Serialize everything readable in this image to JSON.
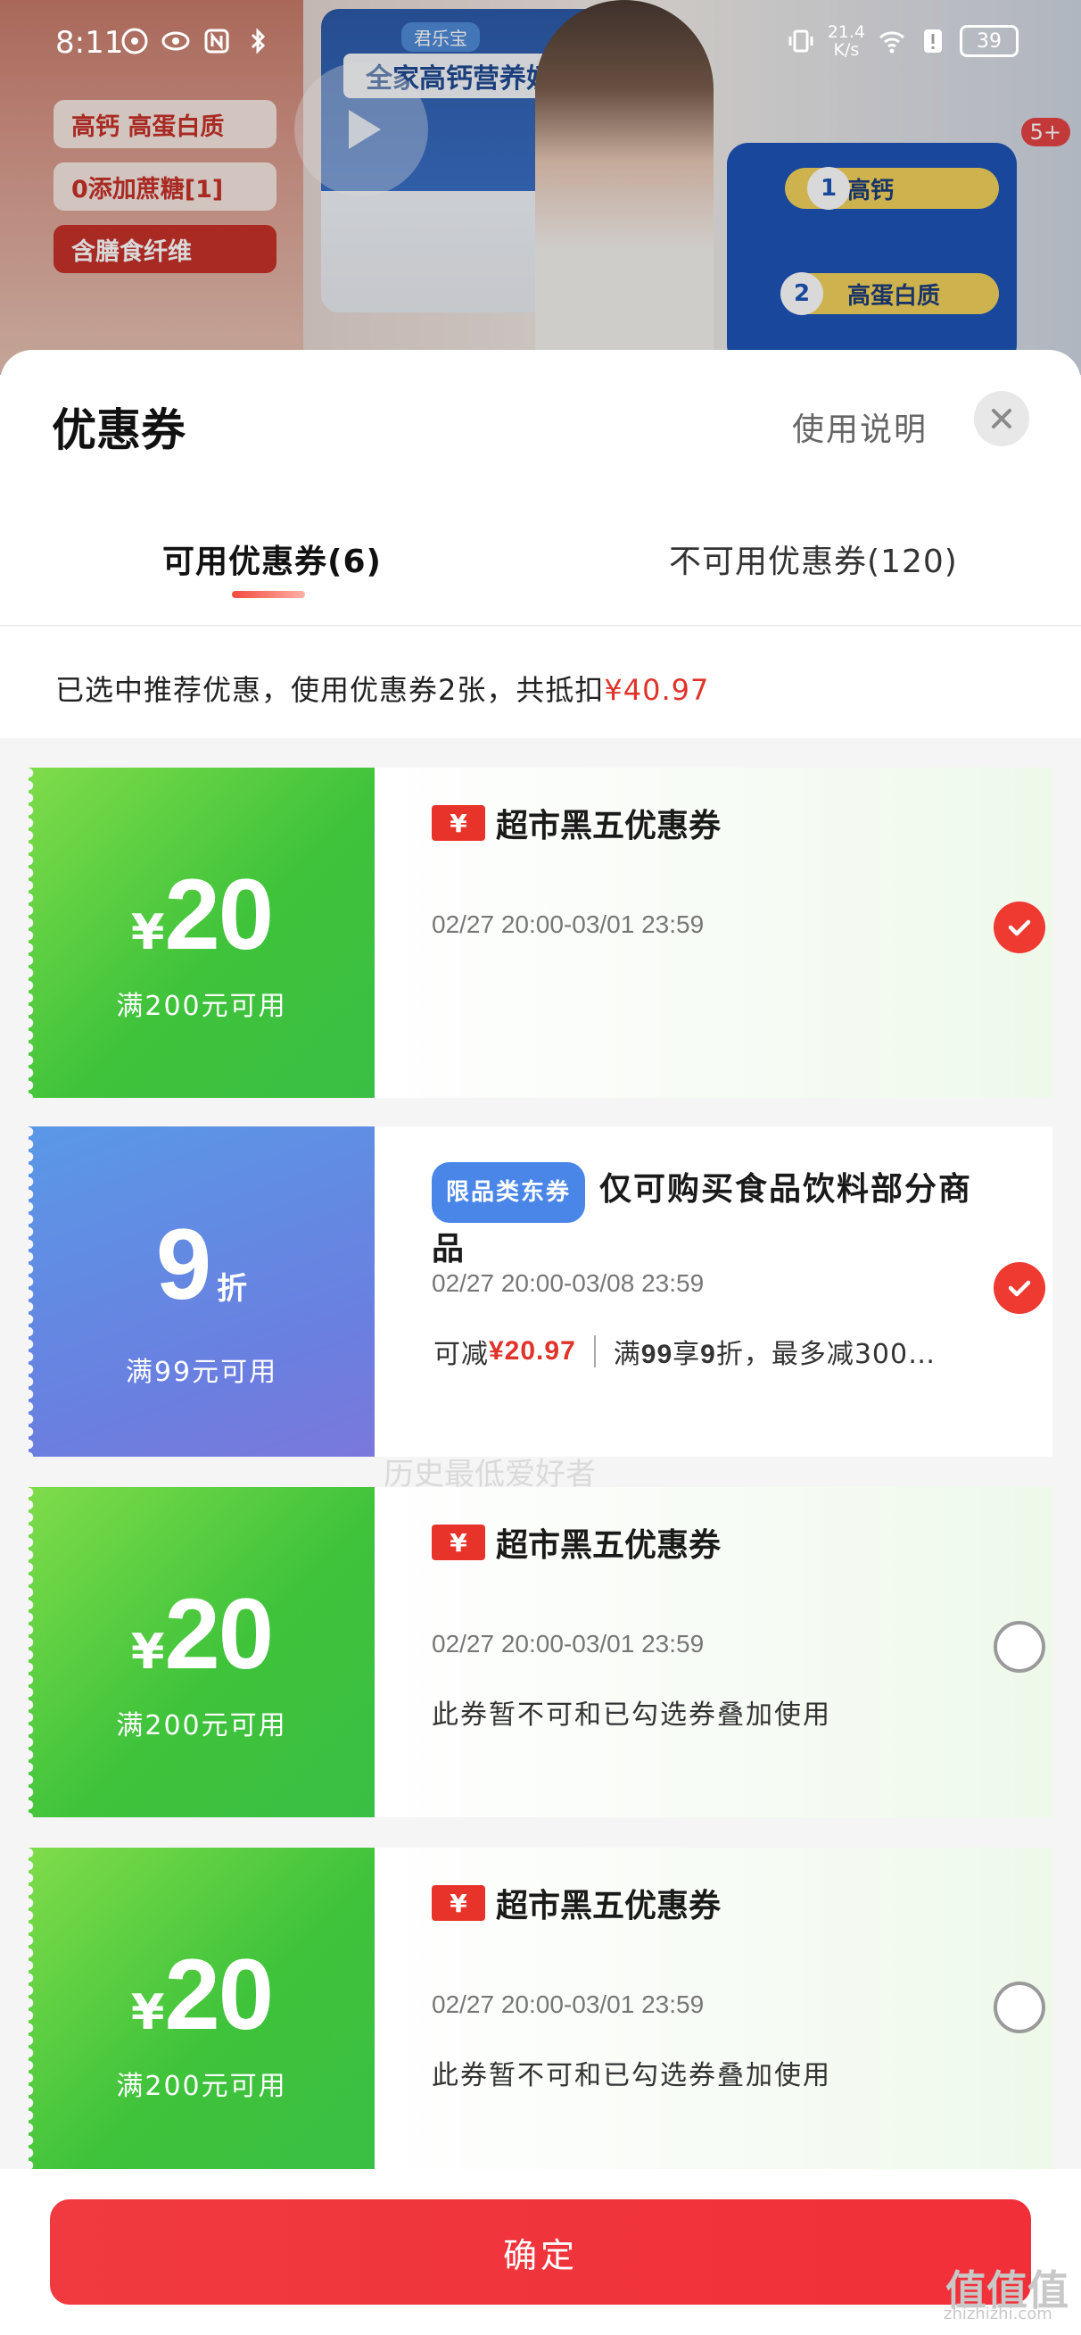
{
  "status_bar": {
    "time": "8:11",
    "net_speed": "21.4",
    "net_unit": "K/s",
    "battery": "39"
  },
  "background": {
    "brand": "君乐宝",
    "product": "全家高钙营养奶粉",
    "features": [
      "高钙 高蛋白质",
      "0添加蔗糖[1]",
      "含膳食纤维"
    ],
    "side_items": [
      "高钙",
      "高蛋白质"
    ],
    "badge": "5+"
  },
  "sheet": {
    "title": "优惠券",
    "usage_link": "使用说明",
    "tabs": [
      {
        "label": "可用优惠券(6)"
      },
      {
        "label": "不可用优惠券(120)"
      }
    ],
    "summary_prefix": "已选中推荐优惠，使用优惠券2张，共抵扣",
    "summary_amount": "¥40.97"
  },
  "coupons": [
    {
      "currency": "¥",
      "value": "20",
      "condition": "满200元可用",
      "badge": "¥",
      "title": "超市黑五优惠券",
      "date": "02/27 20:00-03/01 23:59",
      "note": ""
    },
    {
      "value": "9",
      "unit": "折",
      "condition": "满99元可用",
      "tag": "限品类东券",
      "title": "仅可购买食品饮料部分商品",
      "date": "02/27 20:00-03/08 23:59",
      "saving_label": "可减",
      "saving_amount": "¥20.97",
      "rule_a": "满",
      "rule_b": "99",
      "rule_c": "享",
      "rule_d": "9",
      "rule_e": "折，最多减300…"
    },
    {
      "currency": "¥",
      "value": "20",
      "condition": "满200元可用",
      "badge": "¥",
      "title": "超市黑五优惠券",
      "date": "02/27 20:00-03/01 23:59",
      "note": "此券暂不可和已勾选券叠加使用"
    },
    {
      "currency": "¥",
      "value": "20",
      "condition": "满200元可用",
      "badge": "¥",
      "title": "超市黑五优惠券",
      "date": "02/27 20:00-03/01 23:59",
      "note": "此券暂不可和已勾选券叠加使用"
    }
  ],
  "watermark": "历史最低爱好者",
  "footer": {
    "confirm_label": "确定",
    "site_logo": "值值值",
    "site_url": "zhizhizhi.com"
  },
  "colors": {
    "accent_red": "#e8332b",
    "green_coupon": "#3fc33b",
    "blue_coupon": "#5a8ce6"
  }
}
